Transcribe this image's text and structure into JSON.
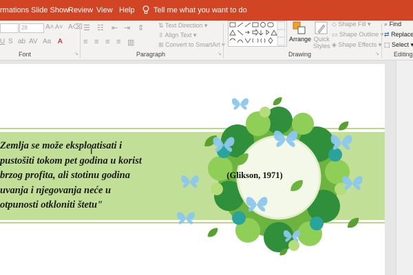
{
  "menu": {
    "tabs": [
      "rmations",
      "Slide Show",
      "Review",
      "View",
      "Help"
    ],
    "tell_me": "Tell me what you want to do"
  },
  "ribbon": {
    "font": {
      "label": "Font",
      "size_value": "28",
      "underline_icon": "U",
      "aa_label": "Aa"
    },
    "paragraph": {
      "label": "Paragraph",
      "text_direction": "Text Direction",
      "align_text": "Align Text",
      "convert_smartart": "Convert to SmartArt"
    },
    "drawing": {
      "label": "Drawing",
      "arrange": "Arrange",
      "quick_styles": "Quick\nStyles",
      "shape_fill": "Shape Fill",
      "shape_outline": "Shape Outline",
      "shape_effects": "Shape Effects"
    },
    "editing": {
      "label": "Editing",
      "find": "Find",
      "replace": "Replace",
      "select": "Select"
    }
  },
  "slide": {
    "quote_lines": [
      "Zemlja se može eksploatisati i",
      "pustošiti tokom pet godina u korist",
      "brzog profita, ali stotinu godina",
      "uvanja i njegovanja neće u",
      "otpunosti otkloniti štetu\""
    ],
    "citation": "(Glikson, 1971)"
  },
  "colors": {
    "title_bar": "#d14424",
    "band_green": "#c2df97",
    "leaf_green": "#6db33f",
    "dark_green": "#2f8f3a",
    "teal": "#2aa39a",
    "butterfly_blue": "#8cc8ee"
  }
}
